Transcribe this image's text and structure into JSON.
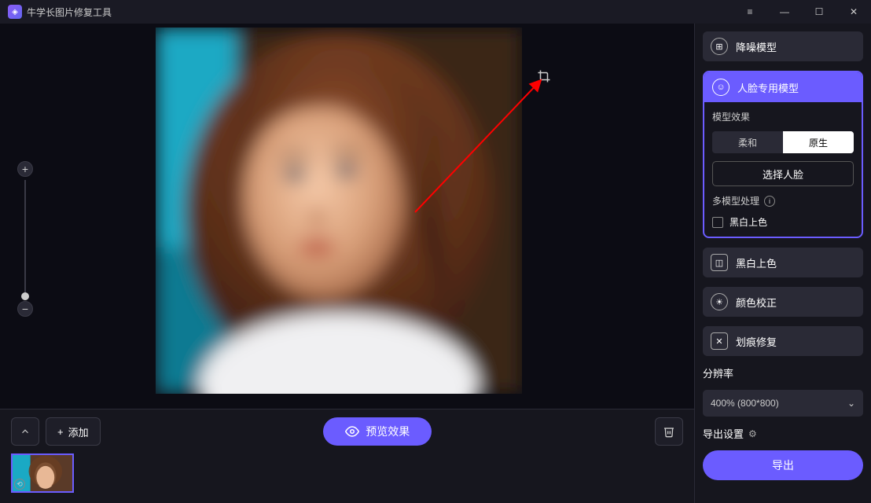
{
  "app": {
    "title": "牛学长图片修复工具"
  },
  "toolbar": {
    "add_label": "添加",
    "preview_label": "预览效果"
  },
  "models": {
    "denoise": "降噪模型",
    "face": "人脸专用模型",
    "effect_label": "模型效果",
    "effect_soft": "柔和",
    "effect_raw": "原生",
    "select_face": "选择人脸",
    "multi_label": "多模型处理",
    "bw_colorize_check": "黑白上色",
    "bw_colorize": "黑白上色",
    "color_correct": "颜色校正",
    "scratch_repair": "划痕修复"
  },
  "resolution": {
    "title": "分辨率",
    "selected": "400% (800*800)"
  },
  "export": {
    "settings_title": "导出设置",
    "button": "导出"
  }
}
